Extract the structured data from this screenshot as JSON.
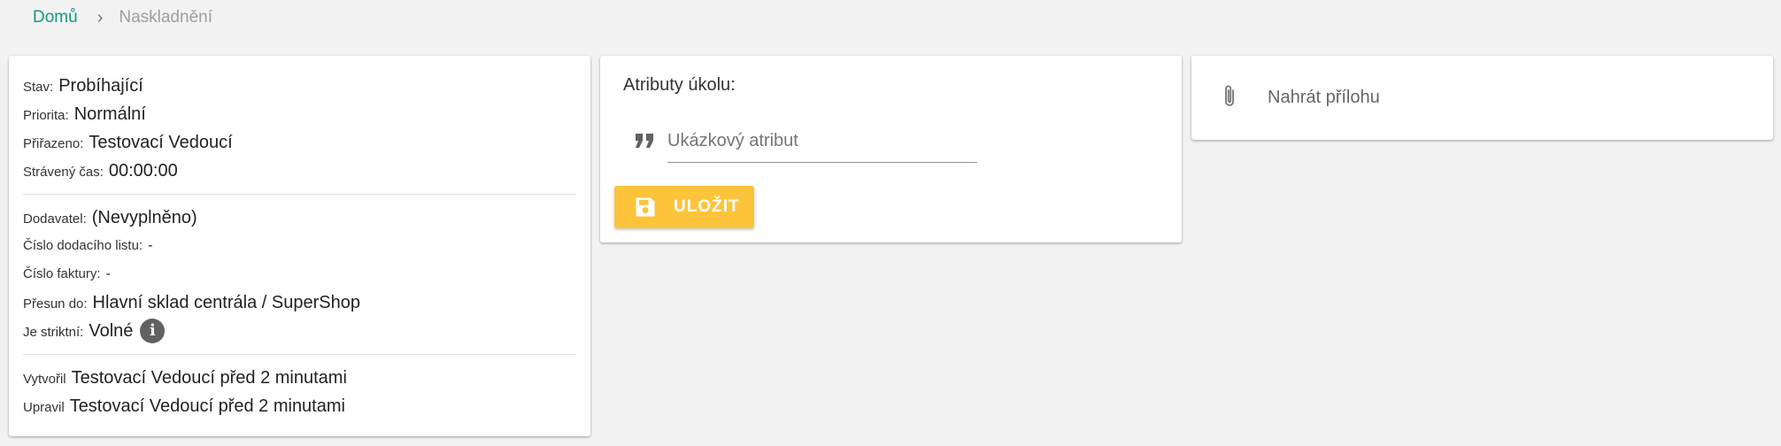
{
  "breadcrumb": {
    "home": "Domů",
    "separator": "›",
    "current": "Naskladnění"
  },
  "info": {
    "status": {
      "label": "Stav:",
      "value": "Probíhající"
    },
    "priority": {
      "label": "Priorita:",
      "value": "Normální"
    },
    "assigned": {
      "label": "Přiřazeno:",
      "value": "Testovací Vedoucí"
    },
    "time_spent": {
      "label": "Strávený čas:",
      "value": "00:00:00"
    },
    "supplier": {
      "label": "Dodavatel:",
      "value": "(Nevyplněno)"
    },
    "delivery_note": {
      "label": "Číslo dodacího listu:",
      "value": "-"
    },
    "invoice": {
      "label": "Číslo faktury:",
      "value": "-"
    },
    "transfer_to": {
      "label": "Přesun do:",
      "value": "Hlavní sklad centrála / SuperShop"
    },
    "strict": {
      "label": "Je striktní:",
      "value": "Volné",
      "icon": "info-icon"
    },
    "created": {
      "label": "Vytvořil",
      "value": "Testovací Vedoucí před 2 minutami"
    },
    "updated": {
      "label": "Upravil",
      "value": "Testovací Vedoucí před 2 minutami"
    }
  },
  "attributes": {
    "title": "Atributy úkolu:",
    "input_placeholder": "Ukázkový atribut",
    "input_value": "",
    "input_icon": "quote-icon",
    "save_label": "ULOŽIT",
    "save_icon": "floppy-disk-icon"
  },
  "upload": {
    "label": "Nahrát přílohu",
    "icon": "paperclip-icon"
  },
  "colors": {
    "accent": "#159688",
    "button": "#fdc33b",
    "background": "#f2f2f2"
  }
}
